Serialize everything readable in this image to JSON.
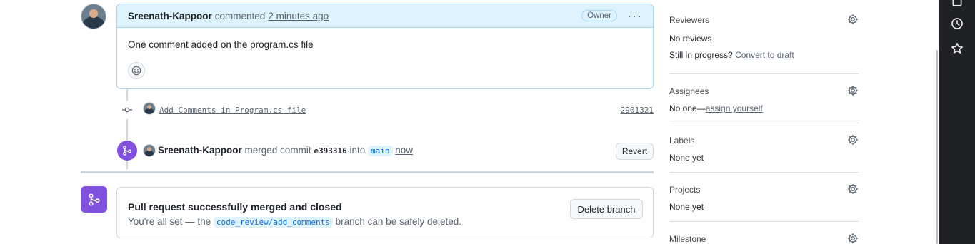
{
  "comment": {
    "author": "Sreenath-Kappoor",
    "verb": "commented",
    "time": "2 minutes ago",
    "badge": "Owner",
    "menu": "···",
    "body": "One comment added on the program.cs file"
  },
  "commit": {
    "message": "Add Comments in Program.cs file",
    "sha": "2901321"
  },
  "merge": {
    "author": "Sreenath-Kappoor",
    "text": "merged commit",
    "sha": "e393316",
    "into": "into",
    "branch": "main",
    "time": "now",
    "revert_label": "Revert"
  },
  "merged_box": {
    "title": "Pull request successfully merged and closed",
    "prefix": "You're all set — the",
    "branch": "code_review/add_comments",
    "suffix": "branch can be safely deleted.",
    "delete_label": "Delete branch"
  },
  "sidebar": {
    "reviewers": {
      "title": "Reviewers",
      "value": "No reviews",
      "progress_text": "Still in progress?",
      "progress_link": "Convert to draft"
    },
    "assignees": {
      "title": "Assignees",
      "value_prefix": "No one—",
      "value_link": "assign yourself"
    },
    "labels": {
      "title": "Labels",
      "value": "None yet"
    },
    "projects": {
      "title": "Projects",
      "value": "None yet"
    },
    "milestone": {
      "title": "Milestone"
    }
  },
  "colors": {
    "merged_purple": "#8250df",
    "comment_border": "#a9d5f5",
    "comment_header_bg": "#ddf4ff"
  }
}
